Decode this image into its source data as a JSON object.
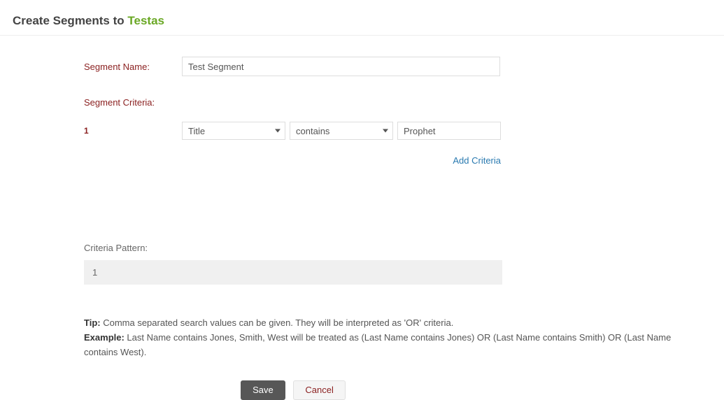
{
  "header": {
    "prefix": "Create Segments to ",
    "accent": "Testas"
  },
  "form": {
    "segment_name_label": "Segment Name:",
    "segment_name_value": "Test Segment",
    "segment_criteria_label": "Segment Criteria:"
  },
  "criteria": {
    "rows": [
      {
        "num": "1",
        "field": "Title",
        "operator": "contains",
        "value": "Prophet"
      }
    ],
    "add_label": "Add Criteria"
  },
  "pattern": {
    "label": "Criteria Pattern:",
    "value": "1"
  },
  "hints": {
    "tip_label": "Tip: ",
    "tip_text": "Comma separated search values can be given. They will be interpreted as 'OR' criteria.",
    "example_label": "Example: ",
    "example_text": "Last Name contains Jones, Smith, West will be treated as (Last Name contains Jones) OR (Last Name contains Smith) OR (Last Name contains West)."
  },
  "actions": {
    "save": "Save",
    "cancel": "Cancel"
  }
}
